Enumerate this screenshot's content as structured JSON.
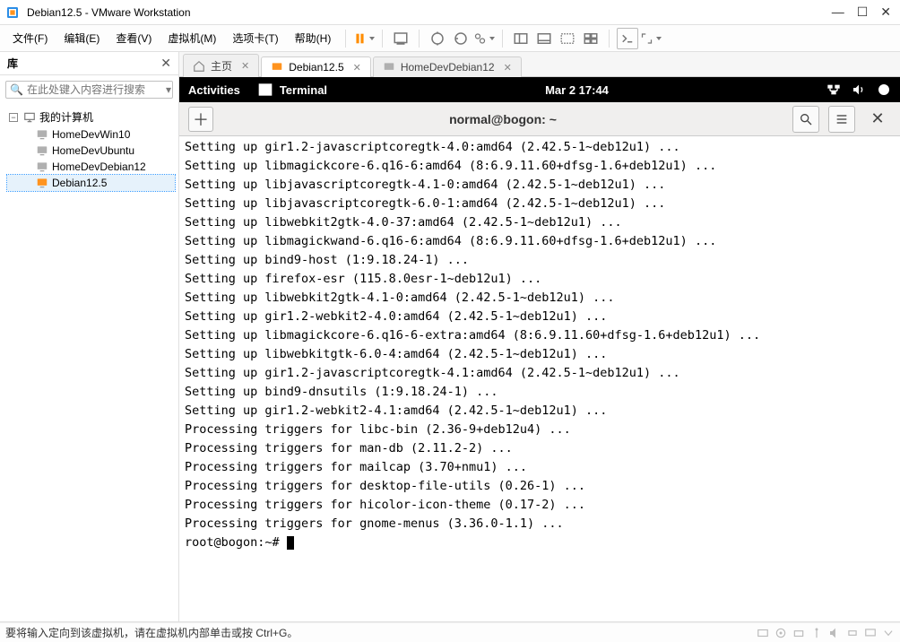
{
  "window": {
    "title": "Debian12.5  - VMware Workstation"
  },
  "menu": {
    "file": "文件(F)",
    "edit": "编辑(E)",
    "view": "查看(V)",
    "vm": "虚拟机(M)",
    "tabs": "选项卡(T)",
    "help": "帮助(H)"
  },
  "sidebar": {
    "title": "库",
    "search_placeholder": "在此处键入内容进行搜索",
    "root": "我的计算机",
    "items": [
      {
        "label": "HomeDevWin10",
        "on": false
      },
      {
        "label": "HomeDevUbuntu",
        "on": false
      },
      {
        "label": "HomeDevDebian12",
        "on": false
      },
      {
        "label": "Debian12.5",
        "on": true,
        "selected": true
      }
    ]
  },
  "tabs": {
    "home": "主页",
    "list": [
      {
        "label": "Debian12.5",
        "on": true,
        "active": true
      },
      {
        "label": "HomeDevDebian12",
        "on": false,
        "active": false
      }
    ]
  },
  "gnome": {
    "activities": "Activities",
    "app": "Terminal",
    "clock": "Mar 2  17:44"
  },
  "terminal_header": {
    "title": "normal@bogon: ~"
  },
  "terminal_lines": [
    "Setting up gir1.2-javascriptcoregtk-4.0:amd64 (2.42.5-1~deb12u1) ...",
    "Setting up libmagickcore-6.q16-6:amd64 (8:6.9.11.60+dfsg-1.6+deb12u1) ...",
    "Setting up libjavascriptcoregtk-4.1-0:amd64 (2.42.5-1~deb12u1) ...",
    "Setting up libjavascriptcoregtk-6.0-1:amd64 (2.42.5-1~deb12u1) ...",
    "Setting up libwebkit2gtk-4.0-37:amd64 (2.42.5-1~deb12u1) ...",
    "Setting up libmagickwand-6.q16-6:amd64 (8:6.9.11.60+dfsg-1.6+deb12u1) ...",
    "Setting up bind9-host (1:9.18.24-1) ...",
    "Setting up firefox-esr (115.8.0esr-1~deb12u1) ...",
    "Setting up libwebkit2gtk-4.1-0:amd64 (2.42.5-1~deb12u1) ...",
    "Setting up gir1.2-webkit2-4.0:amd64 (2.42.5-1~deb12u1) ...",
    "Setting up libmagickcore-6.q16-6-extra:amd64 (8:6.9.11.60+dfsg-1.6+deb12u1) ...",
    "Setting up libwebkitgtk-6.0-4:amd64 (2.42.5-1~deb12u1) ...",
    "Setting up gir1.2-javascriptcoregtk-4.1:amd64 (2.42.5-1~deb12u1) ...",
    "Setting up bind9-dnsutils (1:9.18.24-1) ...",
    "Setting up gir1.2-webkit2-4.1:amd64 (2.42.5-1~deb12u1) ...",
    "Processing triggers for libc-bin (2.36-9+deb12u4) ...",
    "Processing triggers for man-db (2.11.2-2) ...",
    "Processing triggers for mailcap (3.70+nmu1) ...",
    "Processing triggers for desktop-file-utils (0.26-1) ...",
    "Processing triggers for hicolor-icon-theme (0.17-2) ...",
    "Processing triggers for gnome-menus (3.36.0-1.1) ...",
    "root@bogon:~# "
  ],
  "status": {
    "message": "要将输入定向到该虚拟机，请在虚拟机内部单击或按 Ctrl+G。"
  }
}
